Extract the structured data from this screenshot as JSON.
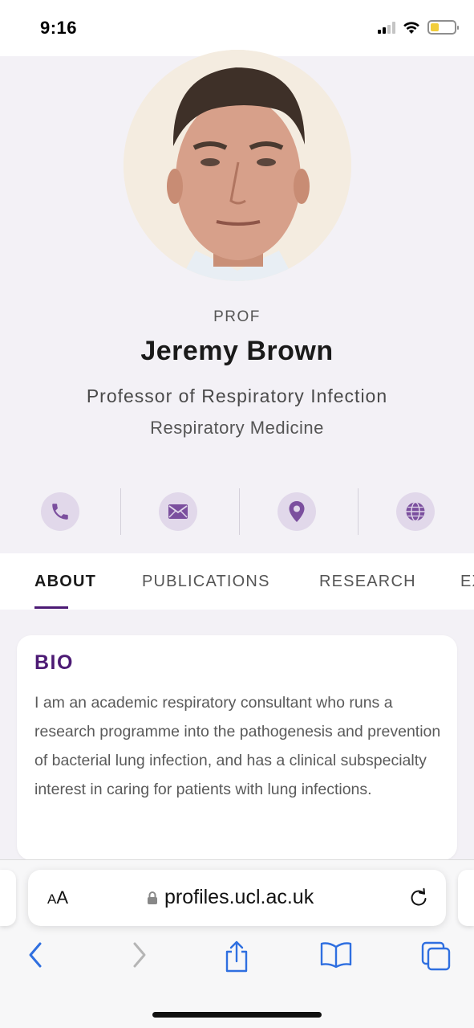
{
  "status_bar": {
    "time": "9:16",
    "icons": [
      "cellular-signal-icon",
      "wifi-icon",
      "battery-icon"
    ],
    "battery_level": 0.35,
    "battery_color": "#f2cd3a"
  },
  "profile": {
    "rank": "PROF",
    "name": "Jeremy Brown",
    "title": "Professor of Respiratory Infection",
    "department": "Respiratory Medicine",
    "contact_icons": [
      "phone-icon",
      "email-icon",
      "location-pin-icon",
      "globe-icon"
    ]
  },
  "tabs": [
    {
      "label": "ABOUT",
      "active": true
    },
    {
      "label": "PUBLICATIONS",
      "active": false
    },
    {
      "label": "RESEARCH",
      "active": false
    },
    {
      "label": "EX",
      "active": false
    }
  ],
  "bio": {
    "heading": "BIO",
    "text": "I am an academic respiratory consultant who runs a research programme into the pathogenesis and prevention of bacterial lung infection, and has a clinical subspecialty interest in caring for patients with lung infections."
  },
  "browser": {
    "text_size_label_big": "A",
    "text_size_label_small": "A",
    "url": "profiles.ucl.ac.uk",
    "toolbar_icons": [
      "back-icon",
      "forward-icon",
      "share-icon",
      "bookmarks-icon",
      "tabs-icon"
    ]
  },
  "colors": {
    "accent": "#4c1a74",
    "icon_purple": "#7b4f9e",
    "icon_bg": "#e1d8ea",
    "ios_blue": "#2f6fe0"
  }
}
